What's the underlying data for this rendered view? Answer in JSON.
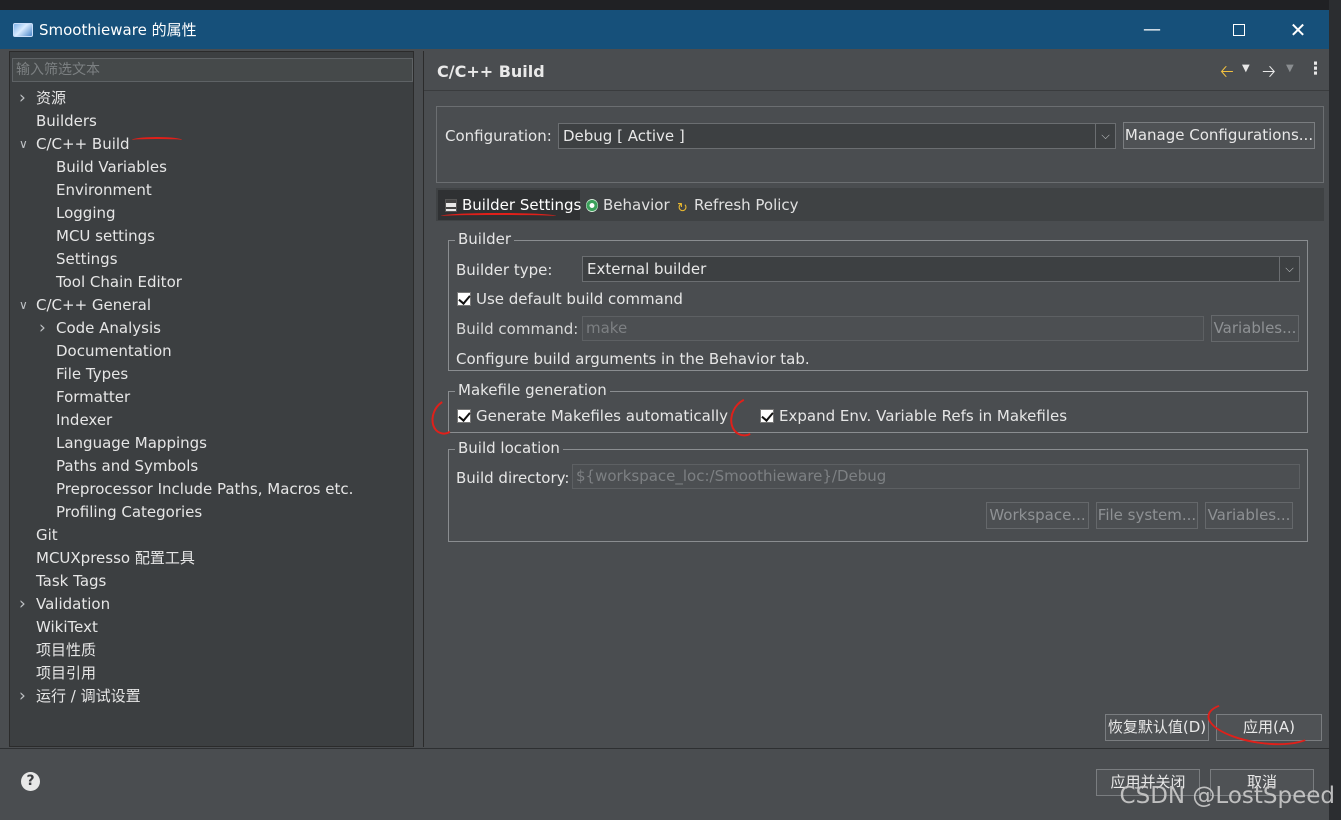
{
  "window": {
    "title": "Smoothieware 的属性"
  },
  "filter": {
    "placeholder": "输入筛选文本"
  },
  "tree": [
    {
      "label": "资源",
      "level": 0,
      "expander": "collapsed"
    },
    {
      "label": "Builders",
      "level": 0,
      "expander": "none"
    },
    {
      "label": "C/C++ Build",
      "level": 0,
      "expander": "expanded"
    },
    {
      "label": "Build Variables",
      "level": 1,
      "expander": "none"
    },
    {
      "label": "Environment",
      "level": 1,
      "expander": "none"
    },
    {
      "label": "Logging",
      "level": 1,
      "expander": "none"
    },
    {
      "label": "MCU settings",
      "level": 1,
      "expander": "none"
    },
    {
      "label": "Settings",
      "level": 1,
      "expander": "none"
    },
    {
      "label": "Tool Chain Editor",
      "level": 1,
      "expander": "none"
    },
    {
      "label": "C/C++ General",
      "level": 0,
      "expander": "expanded"
    },
    {
      "label": "Code Analysis",
      "level": 1,
      "expander": "collapsed"
    },
    {
      "label": "Documentation",
      "level": 1,
      "expander": "none"
    },
    {
      "label": "File Types",
      "level": 1,
      "expander": "none"
    },
    {
      "label": "Formatter",
      "level": 1,
      "expander": "none"
    },
    {
      "label": "Indexer",
      "level": 1,
      "expander": "none"
    },
    {
      "label": "Language Mappings",
      "level": 1,
      "expander": "none"
    },
    {
      "label": "Paths and Symbols",
      "level": 1,
      "expander": "none"
    },
    {
      "label": "Preprocessor Include Paths, Macros etc.",
      "level": 1,
      "expander": "none"
    },
    {
      "label": "Profiling Categories",
      "level": 1,
      "expander": "none"
    },
    {
      "label": "Git",
      "level": 0,
      "expander": "none"
    },
    {
      "label": "MCUXpresso 配置工具",
      "level": 0,
      "expander": "none"
    },
    {
      "label": "Task Tags",
      "level": 0,
      "expander": "none"
    },
    {
      "label": "Validation",
      "level": 0,
      "expander": "collapsed"
    },
    {
      "label": "WikiText",
      "level": 0,
      "expander": "none"
    },
    {
      "label": "项目性质",
      "level": 0,
      "expander": "none"
    },
    {
      "label": "项目引用",
      "level": 0,
      "expander": "none"
    },
    {
      "label": "运行 / 调试设置",
      "level": 0,
      "expander": "collapsed"
    }
  ],
  "page": {
    "title": "C/C++ Build"
  },
  "configuration": {
    "label": "Configuration:",
    "value": "Debug  [ Active ]",
    "manage_button": "Manage Configurations..."
  },
  "tabs": [
    {
      "label": "Builder Settings",
      "active": true,
      "icon": "builder-settings-icon"
    },
    {
      "label": "Behavior",
      "active": false,
      "icon": "behavior-icon"
    },
    {
      "label": "Refresh Policy",
      "active": false,
      "icon": "refresh-policy-icon"
    }
  ],
  "builder": {
    "group_title": "Builder",
    "type_label": "Builder type:",
    "type_value": "External builder",
    "use_default_label": "Use default build command",
    "use_default_checked": true,
    "command_label": "Build command:",
    "command_value": "make",
    "variables_button": "Variables...",
    "info_text": "Configure build arguments in the Behavior tab."
  },
  "makefile": {
    "group_title": "Makefile generation",
    "generate_label": "Generate Makefiles automatically",
    "generate_checked": true,
    "expand_label": "Expand Env. Variable Refs in Makefiles",
    "expand_checked": true
  },
  "location": {
    "group_title": "Build location",
    "dir_label": "Build directory:",
    "dir_value": "${workspace_loc:/Smoothieware}/Debug",
    "workspace_button": "Workspace...",
    "filesystem_button": "File system...",
    "variables_button": "Variables..."
  },
  "actions": {
    "restore_defaults": "恢复默认值(D)",
    "apply": "应用(A)",
    "apply_close": "应用并关闭",
    "cancel": "取消"
  },
  "watermark": "CSDN @LostSpeed",
  "colors": {
    "titlebar": "#16507a",
    "background": "#4a4d50",
    "annotation": "#e0201a"
  }
}
